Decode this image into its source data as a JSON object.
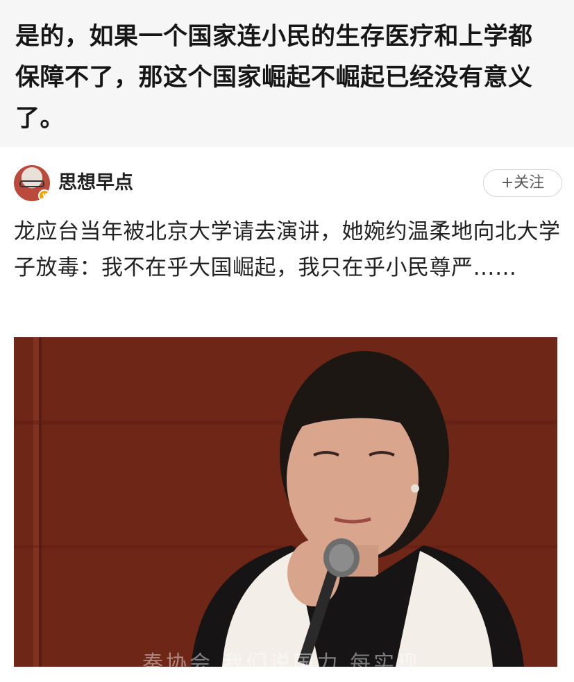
{
  "comment": {
    "text": "是的，如果一个国家连小民的生存医疗和上学都保障不了，那这个国家崛起不崛起已经没有意义了。"
  },
  "post": {
    "author": {
      "name": "思想早点",
      "avatar_icon": "avatar-glasses-icon",
      "verified_badge_icon": "verified-badge-icon"
    },
    "follow_label": "+关注",
    "text": "龙应台当年被北京大学请去演讲，她婉约温柔地向北大学子放毒：我不在乎大国崛起，我只在乎小民尊严……",
    "video": {
      "subtitle_partial": "奏协会 我们说国力 每实现"
    }
  },
  "colors": {
    "page_background": "#f6f6f6",
    "card_background": "#ffffff",
    "video_background": "#6a2416",
    "text_primary": "#161616"
  }
}
